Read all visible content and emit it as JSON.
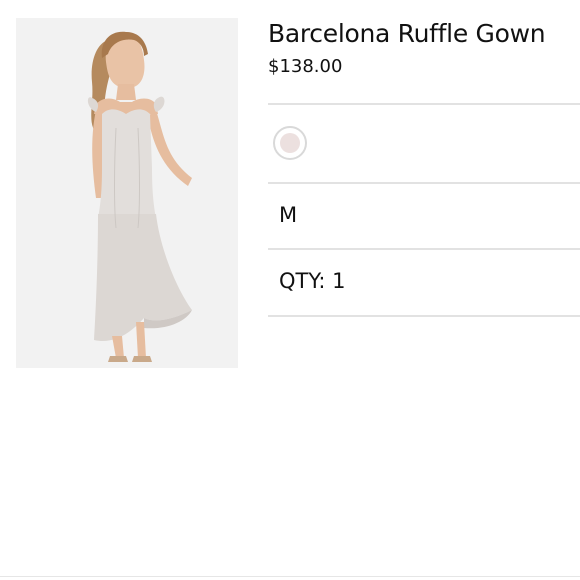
{
  "product": {
    "title": "Barcelona Ruffle Gown",
    "price": "$138.00",
    "color_swatch": "#ece0df",
    "size": "M",
    "quantity": "QTY: 1",
    "image_icon": "dress-model-photo"
  }
}
